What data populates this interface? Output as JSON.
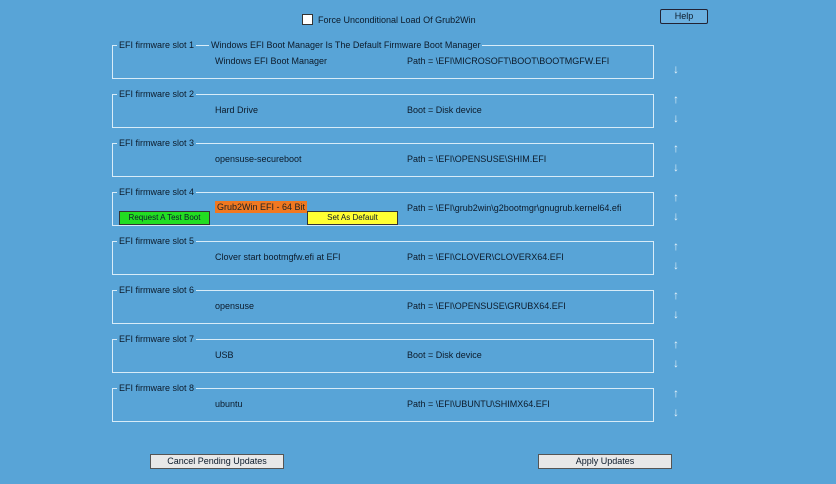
{
  "force_checkbox": {
    "label": "Force Unconditional Load Of Grub2Win",
    "checked": false
  },
  "help_label": "Help",
  "default_note": "Windows EFI Boot Manager Is The Default Firmware Boot Manager",
  "slots": [
    {
      "label": "EFI firmware slot 1",
      "name": "Windows EFI Boot Manager",
      "path": "Path = \\EFI\\MICROSOFT\\BOOT\\BOOTMGFW.EFI"
    },
    {
      "label": "EFI firmware slot 2",
      "name": "Hard Drive",
      "path": "Boot = Disk device"
    },
    {
      "label": "EFI firmware slot 3",
      "name": "opensuse-secureboot",
      "path": "Path = \\EFI\\OPENSUSE\\SHIM.EFI"
    },
    {
      "label": "EFI firmware slot 4",
      "name": "Grub2Win EFI - 64 Bit",
      "path": "Path = \\EFI\\grub2win\\g2bootmgr\\gnugrub.kernel64.efi",
      "test_boot": "Request A Test Boot",
      "set_default": "Set As Default"
    },
    {
      "label": "EFI firmware slot 5",
      "name": "Clover start bootmgfw.efi at EFI",
      "path": "Path = \\EFI\\CLOVER\\CLOVERX64.EFI"
    },
    {
      "label": "EFI firmware slot 6",
      "name": "opensuse",
      "path": "Path = \\EFI\\OPENSUSE\\GRUBX64.EFI"
    },
    {
      "label": "EFI firmware slot 7",
      "name": "USB",
      "path": "Boot = Disk device"
    },
    {
      "label": "EFI firmware slot 8",
      "name": "ubuntu",
      "path": "Path = \\EFI\\UBUNTU\\SHIMX64.EFI"
    }
  ],
  "cancel_label": "Cancel Pending Updates",
  "apply_label": "Apply Updates"
}
